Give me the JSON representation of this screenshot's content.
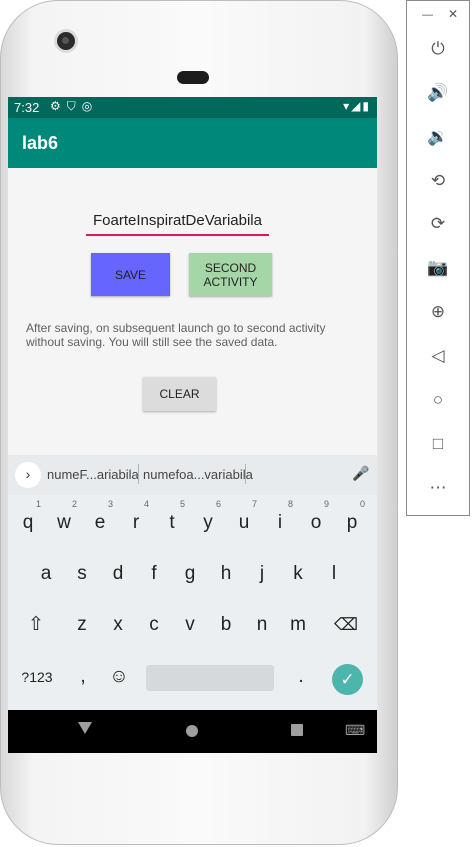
{
  "status_bar": {
    "time": "7:32",
    "left_icons": [
      "settings-icon",
      "shield-icon",
      "sync-icon"
    ],
    "right_icons": [
      "wifi-icon",
      "signal-icon",
      "battery-icon"
    ]
  },
  "app_bar": {
    "title": "lab6"
  },
  "form": {
    "text_value": "FoarteInspiratDeVariabila",
    "save_label": "SAVE",
    "second_activity_label": "SECOND\nACTIVITY",
    "hint": "After saving, on subsequent launch go to second activity without saving. You will still see the saved data.",
    "clear_label": "CLEAR"
  },
  "keyboard": {
    "suggestions": [
      "numeF...ariabila",
      "numefoa...variabila"
    ],
    "row1": [
      {
        "k": "q",
        "n": "1"
      },
      {
        "k": "w",
        "n": "2"
      },
      {
        "k": "e",
        "n": "3"
      },
      {
        "k": "r",
        "n": "4"
      },
      {
        "k": "t",
        "n": "5"
      },
      {
        "k": "y",
        "n": "6"
      },
      {
        "k": "u",
        "n": "7"
      },
      {
        "k": "i",
        "n": "8"
      },
      {
        "k": "o",
        "n": "9"
      },
      {
        "k": "p",
        "n": "0"
      }
    ],
    "row2": [
      "a",
      "s",
      "d",
      "f",
      "g",
      "h",
      "j",
      "k",
      "l"
    ],
    "row3": [
      "z",
      "x",
      "c",
      "v",
      "b",
      "n",
      "m"
    ],
    "sym_label": "?123",
    "comma": ",",
    "period": "."
  },
  "colors": {
    "status_bar": "#00695c",
    "app_bar": "#00897b",
    "save_button": "#6666ff",
    "second_button": "#a5d6a7",
    "accent": "#d81b60",
    "enter_key": "#4db6ac"
  },
  "emulator_panel": {
    "window_controls": [
      "minimize-icon",
      "close-icon"
    ],
    "buttons": [
      "power-icon",
      "volume-up-icon",
      "volume-down-icon",
      "rotate-left-icon",
      "rotate-right-icon",
      "camera-icon",
      "zoom-icon",
      "back-icon",
      "home-icon",
      "overview-icon",
      "more-icon"
    ]
  }
}
